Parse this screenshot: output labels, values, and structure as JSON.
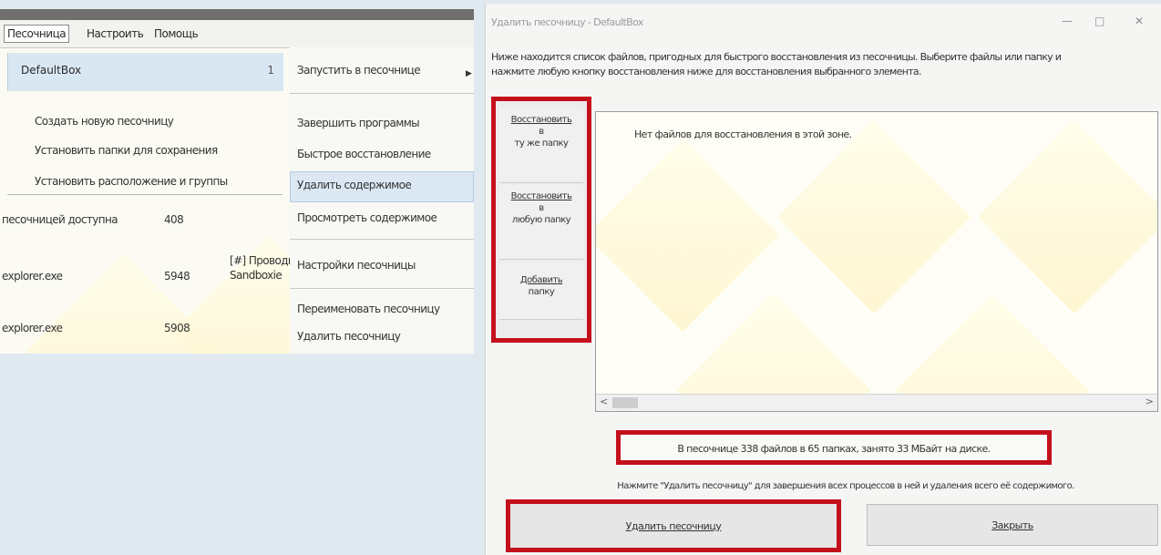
{
  "menu_window": {
    "menubar": [
      "Песочница",
      "Настроить",
      "Помощь"
    ],
    "sandbox": {
      "name": "DefaultBox",
      "count": "1"
    },
    "context_items": [
      "Создать новую песочницу",
      "Установить папки для сохранения",
      "Установить расположение и группы"
    ],
    "processes": [
      {
        "name": "песочницей доступна",
        "pid": "408",
        "title": ""
      },
      {
        "name": "explorer.exe",
        "pid": "5948",
        "title": "[#] Проводник\nSandboxie"
      },
      {
        "name": "explorer.exe",
        "pid": "5908",
        "title": ""
      }
    ],
    "submenu": [
      "Запустить в песочнице",
      "Завершить программы",
      "Быстрое восстановление",
      "Удалить содержимое",
      "Просмотреть содержимое",
      "Настройки песочницы",
      "Переименовать песочницу",
      "Удалить песочницу"
    ],
    "submenu_highlight_index": 3
  },
  "dialog": {
    "title": "Удалить песочницу - DefaultBox",
    "description": [
      "Ниже находится список файлов, пригодных для быстрого восстановления из песочницы. Выберите файлы или папку и",
      "нажмите любую кнопку восстановления ниже для восстановления выбранного элемента."
    ],
    "side_buttons": [
      [
        "Восстановить",
        "в",
        "ту же папку"
      ],
      [
        "Восстановить",
        "в",
        "любую папку"
      ],
      [
        "Добавить",
        "папку"
      ]
    ],
    "empty_text": "Нет файлов для восстановления в этой зоне.",
    "status": "В песочнице 338 файлов в 65 папках, занято 33 МБайт на диске.",
    "hint": "Нажмите \"Удалить песочницу\" для завершения всех процессов в ней и удаления всего её содержимого.",
    "delete_button": "Удалить песочницу",
    "close_button": "Закрыть",
    "window_controls": [
      "—",
      "□",
      "✕"
    ]
  },
  "colors": {
    "highlight": "#c4101c",
    "selection": "#dbe8f4"
  }
}
